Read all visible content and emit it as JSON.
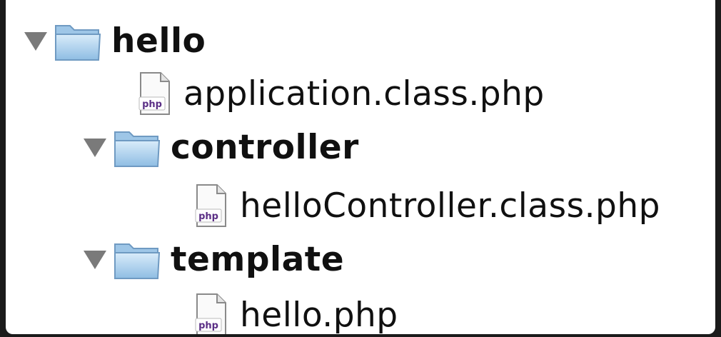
{
  "tree": {
    "root": {
      "label": "hello",
      "icon": "folder-icon",
      "expanded": true
    },
    "items": [
      {
        "label": "application.class.php",
        "icon": "php-file-icon",
        "badge": "php"
      },
      {
        "label": "controller",
        "icon": "folder-icon",
        "expanded": true
      },
      {
        "label": "helloController.class.php",
        "icon": "php-file-icon",
        "badge": "php"
      },
      {
        "label": "template",
        "icon": "folder-icon",
        "expanded": true
      },
      {
        "label": "hello.php",
        "icon": "php-file-icon",
        "badge": "php"
      }
    ]
  },
  "colors": {
    "background": "#1b1b1b",
    "panel": "#ffffff",
    "folder_blue": "#a9cdea",
    "disclosure_gray": "#7a7a7a",
    "php_badge": "#5b2f86"
  }
}
